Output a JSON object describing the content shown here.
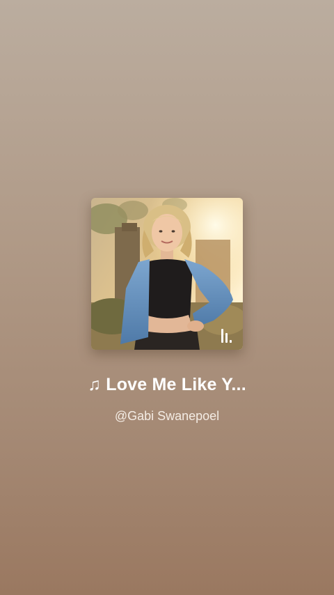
{
  "track": {
    "title_icon": "music-note-icon",
    "title": "♫ Love Me Like Y...",
    "artist": "@Gabi Swanepoel"
  },
  "cover_art": {
    "badge_icon": "audio-bars-icon"
  },
  "colors": {
    "background_top": "#bbad9f",
    "background_bottom": "#9a7860",
    "text": "#ffffff",
    "subtext": "#f4ece4"
  }
}
